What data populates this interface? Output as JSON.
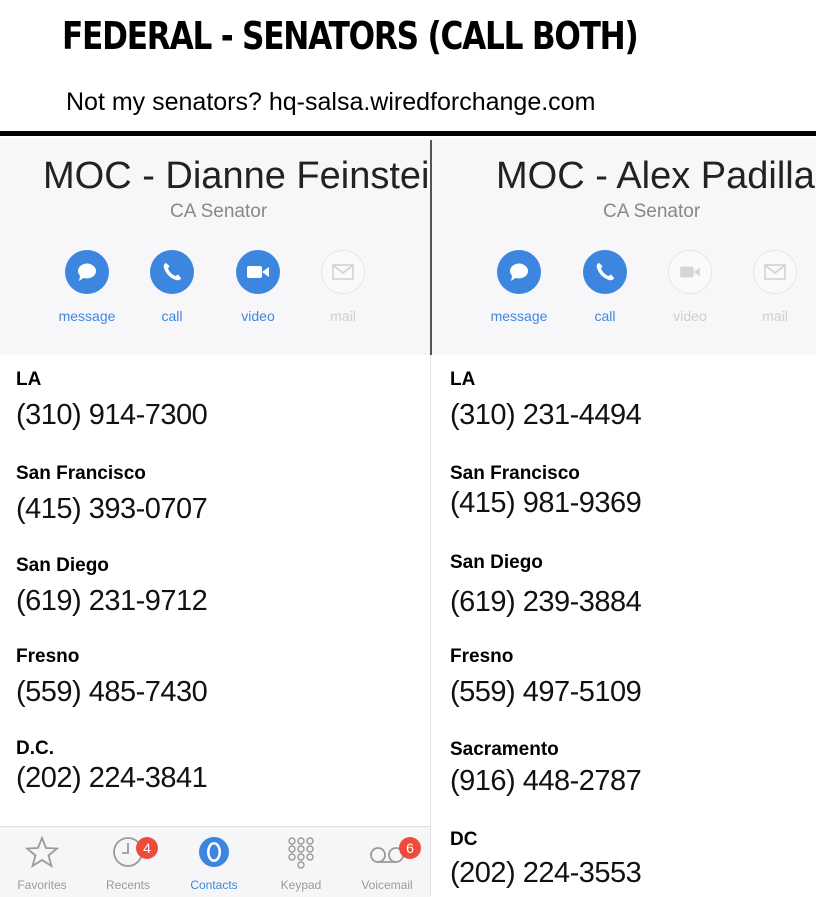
{
  "header": {
    "title": "FEDERAL - SENATORS (CALL BOTH)",
    "subtitle": "Not my senators? hq-salsa.wiredforchange.com"
  },
  "left": {
    "name": "MOC - Dianne Feinstein",
    "role": "CA Senator",
    "actions": [
      {
        "label": "message",
        "icon": "message-icon",
        "enabled": true
      },
      {
        "label": "call",
        "icon": "phone-icon",
        "enabled": true
      },
      {
        "label": "video",
        "icon": "video-icon",
        "enabled": true
      },
      {
        "label": "mail",
        "icon": "mail-icon",
        "enabled": false
      }
    ],
    "offices": [
      {
        "city": "LA",
        "phone": "(310) 914-7300"
      },
      {
        "city": "San Francisco",
        "phone": "(415) 393-0707"
      },
      {
        "city": "San Diego",
        "phone": "(619) 231-9712"
      },
      {
        "city": "Fresno",
        "phone": "(559) 485-7430"
      },
      {
        "city": "D.C.",
        "phone": "(202) 224-3841"
      }
    ]
  },
  "right": {
    "name": "MOC - Alex Padilla",
    "role": "CA Senator",
    "actions": [
      {
        "label": "message",
        "icon": "message-icon",
        "enabled": true
      },
      {
        "label": "call",
        "icon": "phone-icon",
        "enabled": true
      },
      {
        "label": "video",
        "icon": "video-icon",
        "enabled": false
      },
      {
        "label": "mail",
        "icon": "mail-icon",
        "enabled": false
      }
    ],
    "offices": [
      {
        "city": "LA",
        "phone": "(310) 231-4494"
      },
      {
        "city": "San Francisco",
        "phone": "(415) 981-9369"
      },
      {
        "city": "San Diego",
        "phone": "(619) 239-3884"
      },
      {
        "city": "Fresno",
        "phone": "(559) 497-5109"
      },
      {
        "city": "Sacramento",
        "phone": "(916) 448-2787"
      },
      {
        "city": "DC",
        "phone": "(202) 224-3553"
      }
    ]
  },
  "tabbar": {
    "tabs": [
      {
        "label": "Favorites",
        "icon": "star-icon"
      },
      {
        "label": "Recents",
        "icon": "clock-icon",
        "badge": "4"
      },
      {
        "label": "Contacts",
        "icon": "contacts-icon",
        "active": true
      },
      {
        "label": "Keypad",
        "icon": "keypad-icon"
      },
      {
        "label": "Voicemail",
        "icon": "voicemail-icon",
        "badge": "6"
      }
    ]
  },
  "colors": {
    "accent": "#3d86e0",
    "badge": "#f04a3a",
    "disabled": "#cfcfcf"
  }
}
